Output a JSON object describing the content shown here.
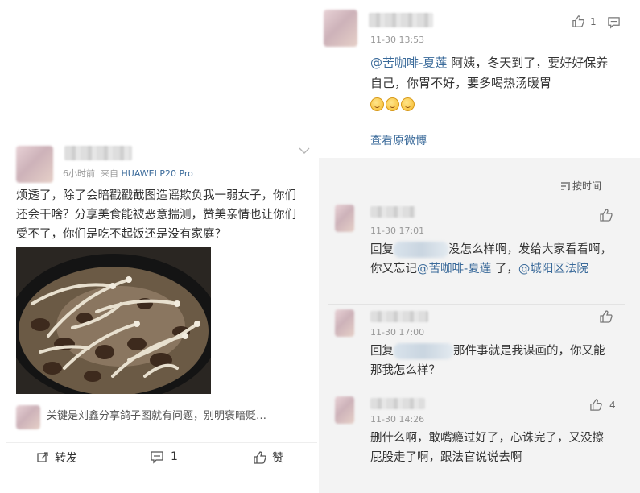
{
  "left_post": {
    "time": "6小时前",
    "source_prefix": "来自",
    "source_device": "HUAWEI P20 Pro",
    "content": "烦透了，除了会暗戳戳截图造谣欺负我一弱女子，你们还会干啥？分享美食能被恶意揣测，赞美亲情也让你们受不了，你们是吃不起饭还是没有家庭？",
    "top_comment": "关键是刘鑫分享鸽子图就有问题，别明褒暗贬…",
    "actions": {
      "repost": "转发",
      "comment_count": "1",
      "like": "赞"
    }
  },
  "top_comment": {
    "time": "11-30 13:53",
    "likes": "1",
    "mention": "@苦咖啡-夏莲",
    "text": " 阿姨，冬天到了，要好好保养自己，你胃不好，要多喝热汤暖胃",
    "view_original": "查看原微博"
  },
  "sort_label": "按时间",
  "comments": [
    {
      "time": "11-30 17:01",
      "reply_prefix": "回复",
      "text_a": "没怎么样啊，发给大家看看啊，你又忘记",
      "mention1": "@苦咖啡-夏莲",
      "text_b": " 了，",
      "mention2": "@城阳区法院"
    },
    {
      "time": "11-30 17:00",
      "reply_prefix": "回复",
      "text": "那件事就是我谋画的，你又能那我怎么样？"
    },
    {
      "time": "11-30 14:26",
      "likes": "4",
      "text": "删什么啊，敢嘴瘾过好了，心诛完了，又没擦屁股走了啊，跟法官说说去啊"
    }
  ],
  "colors": {
    "link": "#3a6a9a",
    "meta": "#999999",
    "body": "#333333",
    "panel": "#f3f3f3"
  },
  "icons": [
    "chevron-down-icon",
    "repost-icon",
    "comment-icon",
    "like-icon",
    "thumb-up-icon",
    "comment-bubble-icon",
    "sort-icon"
  ]
}
